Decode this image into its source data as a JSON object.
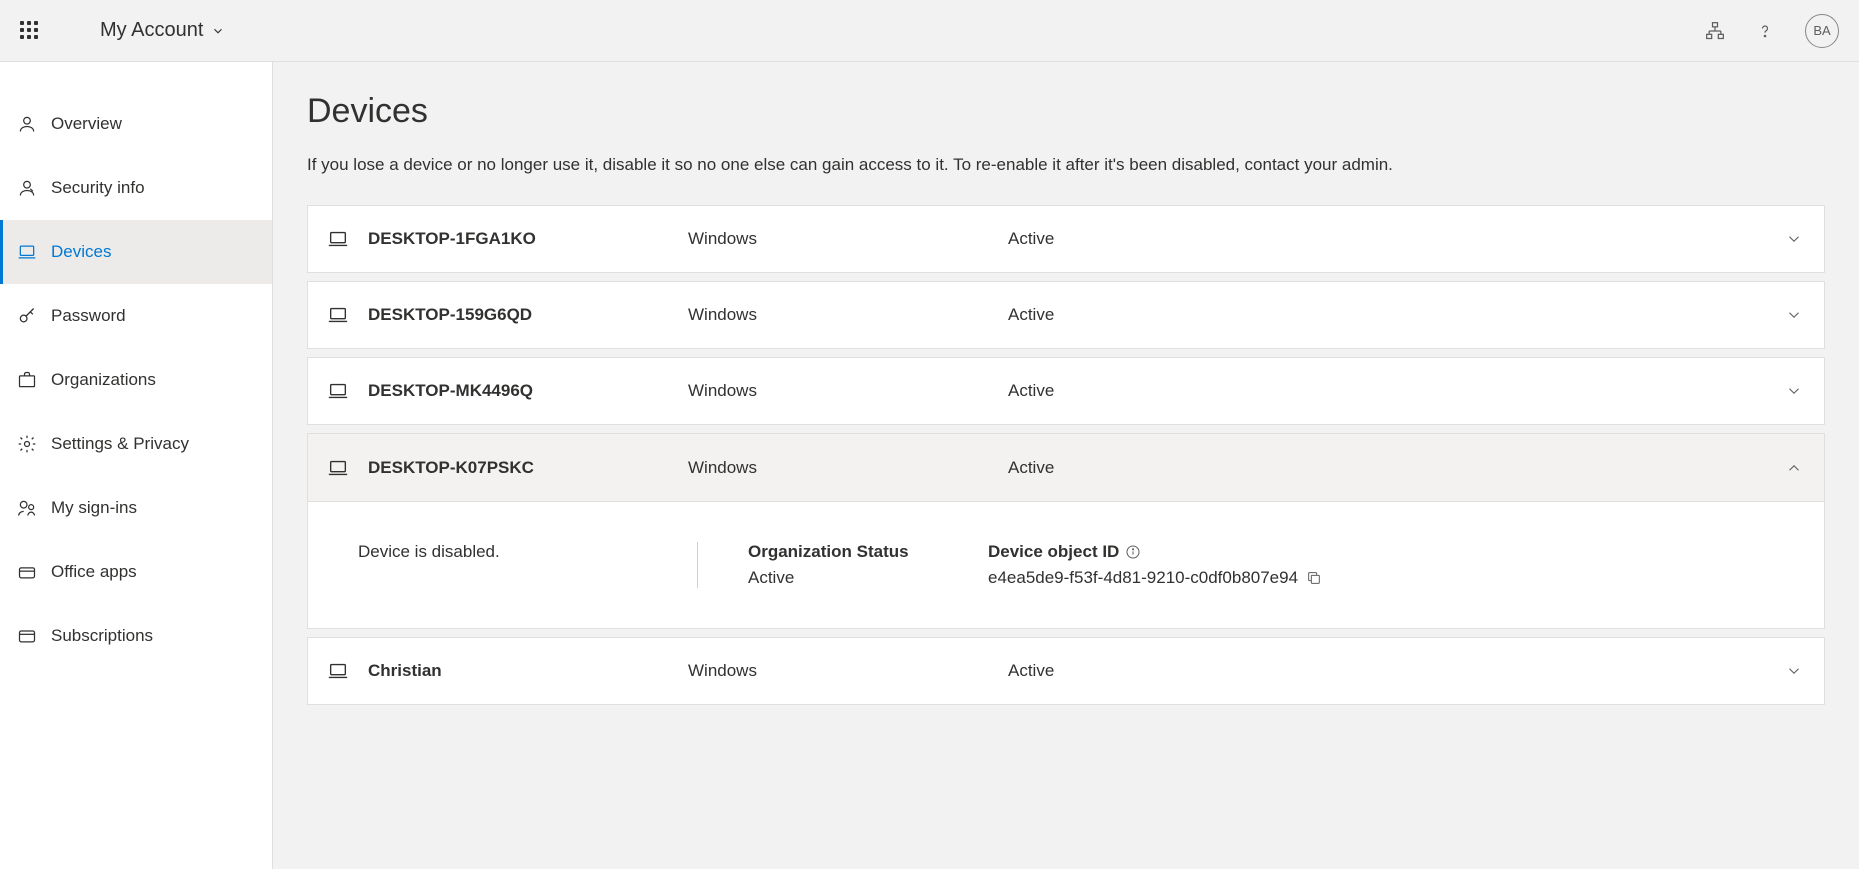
{
  "header": {
    "title": "My Account",
    "avatar_initials": "BA"
  },
  "sidebar": {
    "items": [
      {
        "label": "Overview"
      },
      {
        "label": "Security info"
      },
      {
        "label": "Devices"
      },
      {
        "label": "Password"
      },
      {
        "label": "Organizations"
      },
      {
        "label": "Settings & Privacy"
      },
      {
        "label": "My sign-ins"
      },
      {
        "label": "Office apps"
      },
      {
        "label": "Subscriptions"
      }
    ]
  },
  "page": {
    "title": "Devices",
    "description": "If you lose a device or no longer use it, disable it so no one else can gain access to it. To re-enable it after it's been disabled, contact your admin."
  },
  "devices": [
    {
      "name": "DESKTOP-1FGA1KO",
      "os": "Windows",
      "status": "Active"
    },
    {
      "name": "DESKTOP-159G6QD",
      "os": "Windows",
      "status": "Active"
    },
    {
      "name": "DESKTOP-MK4496Q",
      "os": "Windows",
      "status": "Active"
    },
    {
      "name": "DESKTOP-K07PSKC",
      "os": "Windows",
      "status": "Active"
    },
    {
      "name": "Christian",
      "os": "Windows",
      "status": "Active"
    }
  ],
  "expanded": {
    "disabled_text": "Device is disabled.",
    "org_status_label": "Organization Status",
    "org_status_value": "Active",
    "object_id_label": "Device object ID",
    "object_id_value": "e4ea5de9-f53f-4d81-9210-c0df0b807e94"
  }
}
